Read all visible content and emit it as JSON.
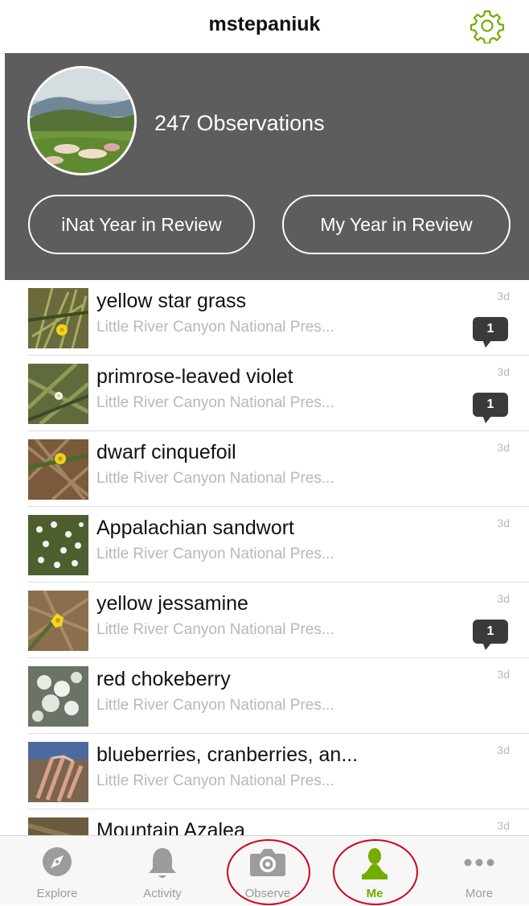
{
  "header": {
    "username": "mstepaniuk",
    "settings_icon": "gear-icon",
    "accent_color": "#74ac00"
  },
  "profile": {
    "observations_label": "247 Observations",
    "buttons": {
      "inat_review": "iNat Year in Review",
      "my_review": "My Year in Review"
    },
    "background_color": "#5d5d5d"
  },
  "observations": [
    {
      "name": "yellow star grass",
      "place": "Little River Canyon National Pres...",
      "time": "3d",
      "comments": "1"
    },
    {
      "name": "primrose-leaved violet",
      "place": "Little River Canyon National Pres...",
      "time": "3d",
      "comments": "1"
    },
    {
      "name": "dwarf cinquefoil",
      "place": "Little River Canyon National Pres...",
      "time": "3d",
      "comments": null
    },
    {
      "name": "Appalachian sandwort",
      "place": "Little River Canyon National Pres...",
      "time": "3d",
      "comments": null
    },
    {
      "name": "yellow jessamine",
      "place": "Little River Canyon National Pres...",
      "time": "3d",
      "comments": "1"
    },
    {
      "name": "red chokeberry",
      "place": "Little River Canyon National Pres...",
      "time": "3d",
      "comments": null
    },
    {
      "name": "blueberries, cranberries, an...",
      "place": "Little River Canyon National Pres...",
      "time": "3d",
      "comments": null
    },
    {
      "name": "Mountain Azalea",
      "place": "",
      "time": "3d",
      "comments": null
    }
  ],
  "tabbar": {
    "tabs": [
      {
        "label": "Explore",
        "icon": "compass-icon"
      },
      {
        "label": "Activity",
        "icon": "bell-icon"
      },
      {
        "label": "Observe",
        "icon": "camera-icon"
      },
      {
        "label": "Me",
        "icon": "person-icon",
        "active": true
      },
      {
        "label": "More",
        "icon": "more-dots-icon"
      }
    ]
  }
}
